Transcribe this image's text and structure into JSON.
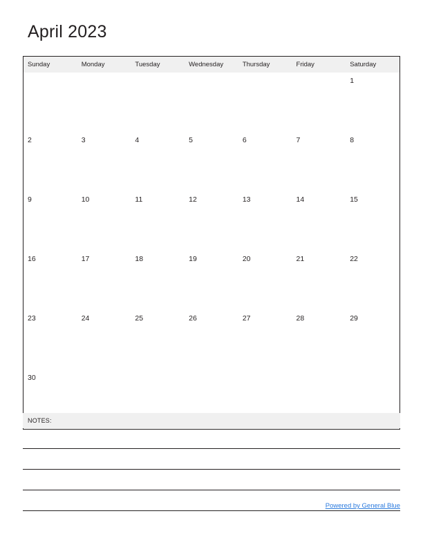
{
  "document": {
    "type": "monthly-calendar",
    "title": "April 2023",
    "month": "April",
    "year": "2023"
  },
  "calendar": {
    "weekday_headers": [
      "Sunday",
      "Monday",
      "Tuesday",
      "Wednesday",
      "Thursday",
      "Friday",
      "Saturday"
    ],
    "weeks": [
      [
        "",
        "",
        "",
        "",
        "",
        "",
        "1"
      ],
      [
        "2",
        "3",
        "4",
        "5",
        "6",
        "7",
        "8"
      ],
      [
        "9",
        "10",
        "11",
        "12",
        "13",
        "14",
        "15"
      ],
      [
        "16",
        "17",
        "18",
        "19",
        "20",
        "21",
        "22"
      ],
      [
        "23",
        "24",
        "25",
        "26",
        "27",
        "28",
        "29"
      ],
      [
        "30",
        "",
        "",
        "",
        "",
        "",
        ""
      ]
    ],
    "header_background": "#f0f0f0",
    "border_color": "#231f20"
  },
  "notes": {
    "label": "NOTES:",
    "bar_background": "#f0f0f0",
    "line_count": 4,
    "lines": [
      "",
      "",
      "",
      ""
    ]
  },
  "footer": {
    "link_text": "Powered by General Blue",
    "link_color": "#2a7ade"
  }
}
